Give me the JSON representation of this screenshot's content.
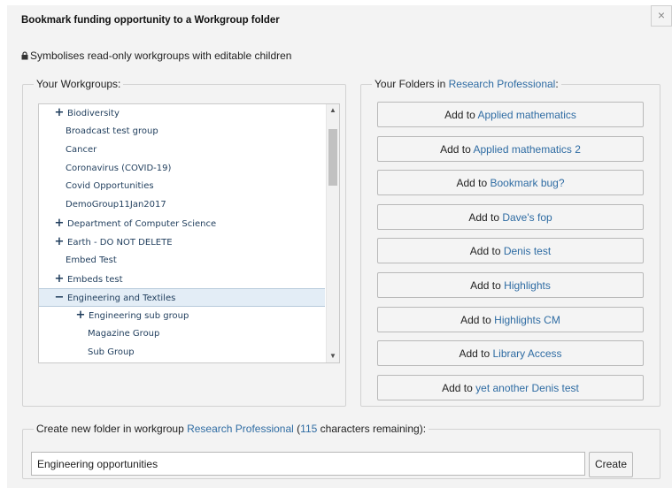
{
  "dialog": {
    "title": "Bookmark funding opportunity to a Workgroup folder",
    "close_glyph": "×",
    "readonly_note": "Symbolises read-only workgroups with editable children"
  },
  "workgroups": {
    "legend": "Your Workgroups:",
    "items": [
      {
        "label": "Biodiversity",
        "expander": "+",
        "level": 0
      },
      {
        "label": "Broadcast test group",
        "expander": "",
        "level": 0
      },
      {
        "label": "Cancer",
        "expander": "",
        "level": 0
      },
      {
        "label": "Coronavirus (COVID-19)",
        "expander": "",
        "level": 0
      },
      {
        "label": "Covid Opportunities",
        "expander": "",
        "level": 0
      },
      {
        "label": "DemoGroup11Jan2017",
        "expander": "",
        "level": 0
      },
      {
        "label": "Department of Computer Science",
        "expander": "+",
        "level": 0
      },
      {
        "label": "Earth - DO NOT DELETE",
        "expander": "+",
        "level": 0
      },
      {
        "label": "Embed Test",
        "expander": "",
        "level": 0
      },
      {
        "label": "Embeds test",
        "expander": "+",
        "level": 0
      },
      {
        "label": "Engineering and Textiles",
        "expander": "−",
        "level": 0,
        "selected": true
      },
      {
        "label": "Engineering sub group",
        "expander": "+",
        "level": 1
      },
      {
        "label": "Magazine Group",
        "expander": "",
        "level": 1
      },
      {
        "label": "Sub Group",
        "expander": "",
        "level": 1
      }
    ]
  },
  "folders": {
    "legend_prefix": "Your Folders in ",
    "legend_group": "Research Professional",
    "legend_suffix": ":",
    "button_prefix": "Add to ",
    "items": [
      "Applied mathematics",
      "Applied mathematics 2",
      "Bookmark bug?",
      "Dave's fop",
      "Denis test",
      "Highlights",
      "Highlights CM",
      "Library Access",
      "yet another Denis test"
    ]
  },
  "new_folder": {
    "legend_prefix": "Create new folder in workgroup ",
    "legend_group": "Research Professional",
    "legend_mid": " (",
    "remaining": "115",
    "legend_suffix": " characters remaining):",
    "value": "Engineering opportunities",
    "create_label": "Create"
  },
  "colors": {
    "link": "#2f6ca3",
    "dialog_bg": "#f3f3f3",
    "selected_row": "#e3edf6"
  }
}
